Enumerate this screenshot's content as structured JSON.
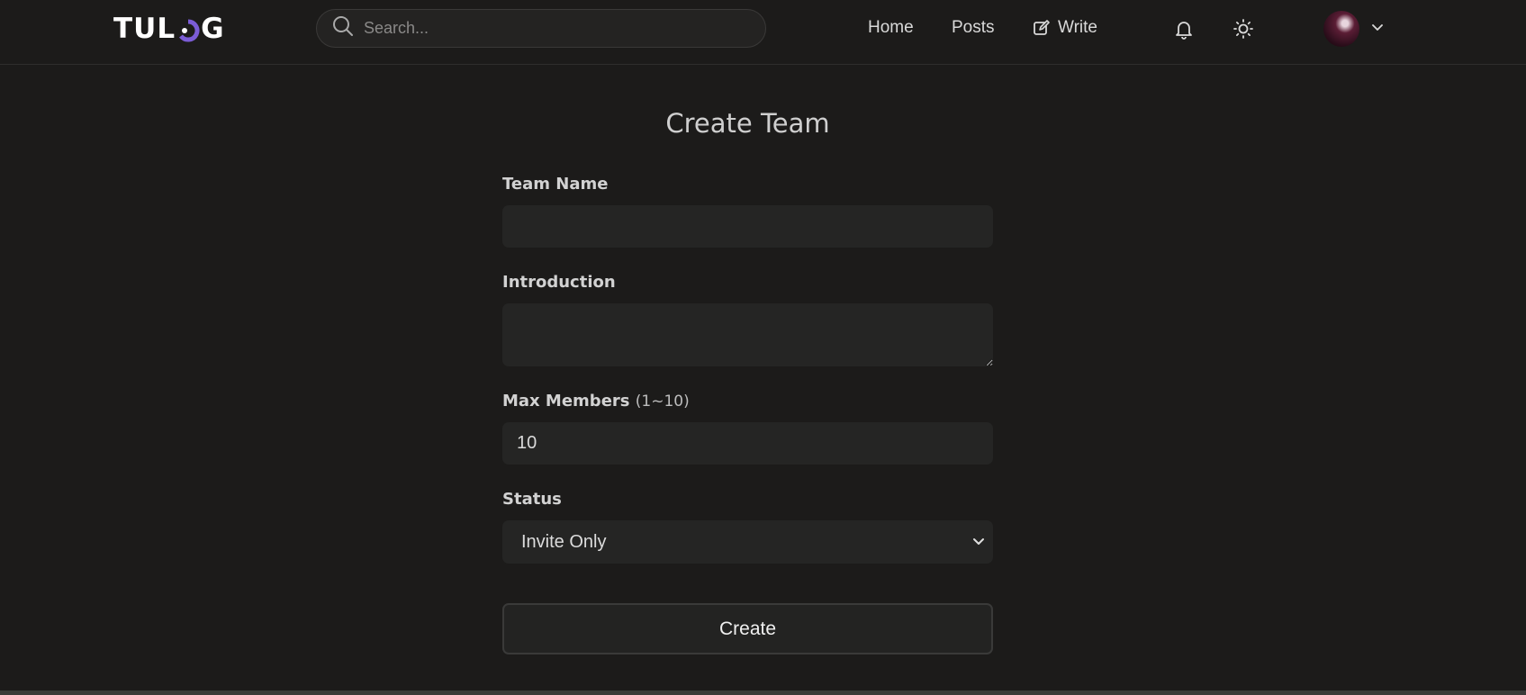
{
  "header": {
    "logo_left": "TUL",
    "logo_right": "G",
    "search_placeholder": "Search...",
    "nav": [
      {
        "label": "Home"
      },
      {
        "label": "Posts"
      },
      {
        "label": "Write"
      }
    ],
    "icons": [
      "bell-icon",
      "sun-icon",
      "chevron-down-icon"
    ]
  },
  "form": {
    "title": "Create Team",
    "team_name_label": "Team Name",
    "team_name_value": "",
    "introduction_label": "Introduction",
    "introduction_value": "",
    "max_members_label": "Max Members",
    "max_members_hint": "(1~10)",
    "max_members_value": "10",
    "status_label": "Status",
    "status_value": "Invite Only",
    "submit_label": "Create"
  },
  "colors": {
    "background": "#1c1b1a",
    "field_background": "#252524",
    "logo_accent": "#7b5cd6"
  }
}
